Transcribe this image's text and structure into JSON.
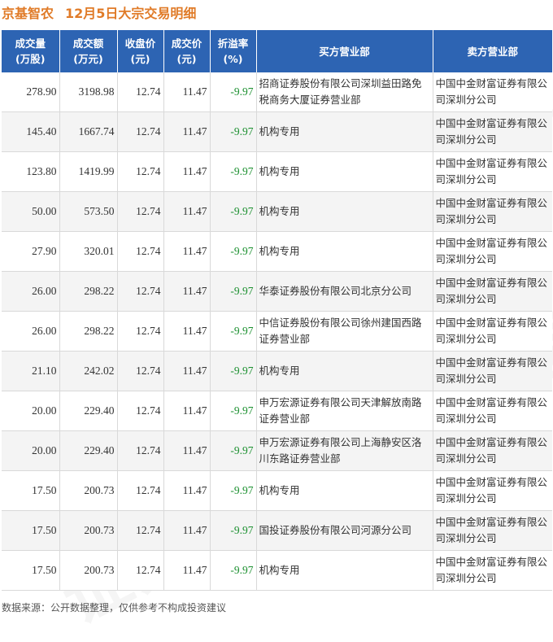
{
  "header": {
    "stock_name": "京基智农",
    "subtitle": "12月5日大宗交易明细"
  },
  "table": {
    "columns": [
      [
        "成交量",
        "(万股)"
      ],
      [
        "成交额",
        "(万元)"
      ],
      [
        "收盘价",
        "(元)"
      ],
      [
        "成交价",
        "(元)"
      ],
      [
        "折溢率",
        "(%)"
      ],
      [
        "买方营业部"
      ],
      [
        "卖方营业部"
      ]
    ],
    "rows": [
      {
        "volume": "278.90",
        "amount": "3198.98",
        "close": "12.74",
        "price": "11.47",
        "premium": "-9.97",
        "buyer": "招商证券股份有限公司深圳益田路免税商务大厦证券营业部",
        "seller": "中国中金财富证券有限公司深圳分公司"
      },
      {
        "volume": "145.40",
        "amount": "1667.74",
        "close": "12.74",
        "price": "11.47",
        "premium": "-9.97",
        "buyer": "机构专用",
        "seller": "中国中金财富证券有限公司深圳分公司"
      },
      {
        "volume": "123.80",
        "amount": "1419.99",
        "close": "12.74",
        "price": "11.47",
        "premium": "-9.97",
        "buyer": "机构专用",
        "seller": "中国中金财富证券有限公司深圳分公司"
      },
      {
        "volume": "50.00",
        "amount": "573.50",
        "close": "12.74",
        "price": "11.47",
        "premium": "-9.97",
        "buyer": "机构专用",
        "seller": "中国中金财富证券有限公司深圳分公司"
      },
      {
        "volume": "27.90",
        "amount": "320.01",
        "close": "12.74",
        "price": "11.47",
        "premium": "-9.97",
        "buyer": "机构专用",
        "seller": "中国中金财富证券有限公司深圳分公司"
      },
      {
        "volume": "26.00",
        "amount": "298.22",
        "close": "12.74",
        "price": "11.47",
        "premium": "-9.97",
        "buyer": "华泰证券股份有限公司北京分公司",
        "seller": "中国中金财富证券有限公司深圳分公司"
      },
      {
        "volume": "26.00",
        "amount": "298.22",
        "close": "12.74",
        "price": "11.47",
        "premium": "-9.97",
        "buyer": "中信证券股份有限公司徐州建国西路证券营业部",
        "seller": "中国中金财富证券有限公司深圳分公司"
      },
      {
        "volume": "21.10",
        "amount": "242.02",
        "close": "12.74",
        "price": "11.47",
        "premium": "-9.97",
        "buyer": "机构专用",
        "seller": "中国中金财富证券有限公司深圳分公司"
      },
      {
        "volume": "20.00",
        "amount": "229.40",
        "close": "12.74",
        "price": "11.47",
        "premium": "-9.97",
        "buyer": "申万宏源证券有限公司天津解放南路证券营业部",
        "seller": "中国中金财富证券有限公司深圳分公司"
      },
      {
        "volume": "20.00",
        "amount": "229.40",
        "close": "12.74",
        "price": "11.47",
        "premium": "-9.97",
        "buyer": "申万宏源证券有限公司上海静安区洛川东路证券营业部",
        "seller": "中国中金财富证券有限公司深圳分公司"
      },
      {
        "volume": "17.50",
        "amount": "200.73",
        "close": "12.74",
        "price": "11.47",
        "premium": "-9.97",
        "buyer": "机构专用",
        "seller": "中国中金财富证券有限公司深圳分公司"
      },
      {
        "volume": "17.50",
        "amount": "200.73",
        "close": "12.74",
        "price": "11.47",
        "premium": "-9.97",
        "buyer": "国投证券股份有限公司河源分公司",
        "seller": "中国中金财富证券有限公司深圳分公司"
      },
      {
        "volume": "17.50",
        "amount": "200.73",
        "close": "12.74",
        "price": "11.47",
        "premium": "-9.97",
        "buyer": "机构专用",
        "seller": "中国中金财富证券有限公司深圳分公司"
      }
    ]
  },
  "footer": {
    "source": "数据来源：公开数据整理，仅供参考不构成投资建议"
  },
  "watermark": {
    "text": "证券之星"
  },
  "colors": {
    "title": "#e07b28",
    "header_bg": "#2d64b3",
    "negative": "#1a8f2e"
  }
}
